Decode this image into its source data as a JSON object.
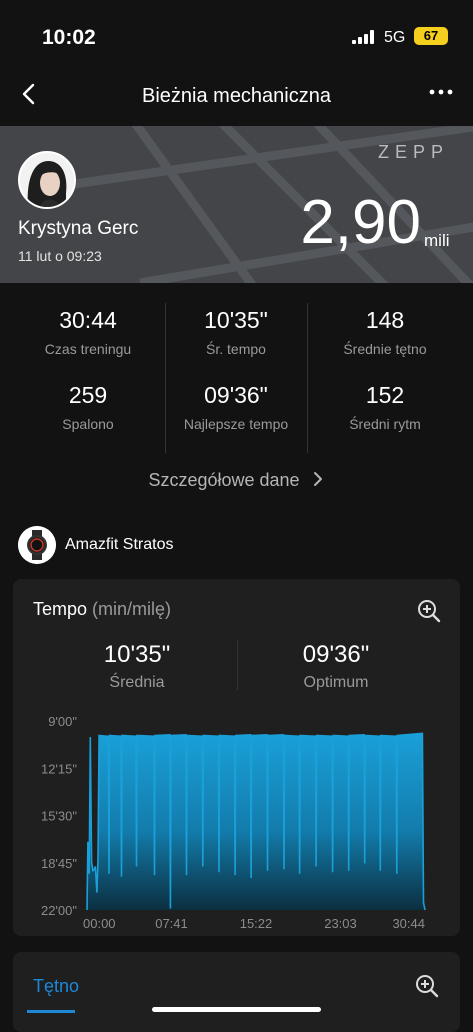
{
  "status": {
    "time": "10:02",
    "network": "5G",
    "battery": "67"
  },
  "header": {
    "title": "Bieżnia mechaniczna",
    "back_icon": "chevron-left-icon",
    "more_icon": "ellipsis-icon"
  },
  "summary": {
    "brand": "ZEPP",
    "user_name": "Krystyna Gerc",
    "date": "11 lut o 09:23",
    "distance": "2,90",
    "distance_unit": "mili"
  },
  "stats": [
    {
      "value": "30:44",
      "label": "Czas treningu"
    },
    {
      "value": "10'35\"",
      "label": "Śr. tempo"
    },
    {
      "value": "148",
      "label": "Średnie tętno"
    },
    {
      "value": "259",
      "label": "Spalono"
    },
    {
      "value": "09'36\"",
      "label": "Najlepsze tempo"
    },
    {
      "value": "152",
      "label": "Średni rytm"
    }
  ],
  "details_link": "Szczegółowe dane",
  "device": {
    "name": "Amazfit Stratos"
  },
  "pace_card": {
    "title": "Tempo",
    "unit": "(min/milę)",
    "average_value": "10'35\"",
    "average_label": "Średnia",
    "best_value": "09'36\"",
    "best_label": "Optimum"
  },
  "chart_data": {
    "type": "area",
    "y_ticks": [
      "9'00\"",
      "12'15\"",
      "15'30\"",
      "18'45\"",
      "22'00\""
    ],
    "x_ticks": [
      "00:00",
      "07:41",
      "15:22",
      "23:03",
      "30:44"
    ],
    "ylim_minutes_per_mile": [
      9.0,
      22.0
    ],
    "y_axis_inverted": true,
    "xlim_seconds": [
      0,
      1844
    ],
    "baseline_pace": 9.85,
    "early_segment": [
      [
        0,
        22
      ],
      [
        5,
        17.3
      ],
      [
        12,
        19.5
      ],
      [
        18,
        10.1
      ],
      [
        25,
        18.7
      ],
      [
        32,
        19.3
      ],
      [
        40,
        19.2
      ],
      [
        46,
        19.0
      ],
      [
        54,
        20.8
      ],
      [
        60,
        18.5
      ],
      [
        66,
        10.0
      ],
      [
        1844,
        22
      ]
    ],
    "dips": [
      [
        120,
        19.5
      ],
      [
        188,
        19.7
      ],
      [
        270,
        19.0
      ],
      [
        368,
        19.6
      ],
      [
        455,
        21.9
      ],
      [
        543,
        19.6
      ],
      [
        632,
        19.0
      ],
      [
        720,
        19.4
      ],
      [
        808,
        19.6
      ],
      [
        895,
        19.8
      ],
      [
        985,
        19.3
      ],
      [
        1075,
        19.2
      ],
      [
        1160,
        19.5
      ],
      [
        1250,
        19.0
      ],
      [
        1340,
        19.4
      ],
      [
        1428,
        19.3
      ],
      [
        1515,
        18.8
      ],
      [
        1600,
        19.3
      ],
      [
        1690,
        19.5
      ]
    ],
    "color": "#1aa0d8"
  },
  "hr_card": {
    "tab_label": "Tętno"
  }
}
